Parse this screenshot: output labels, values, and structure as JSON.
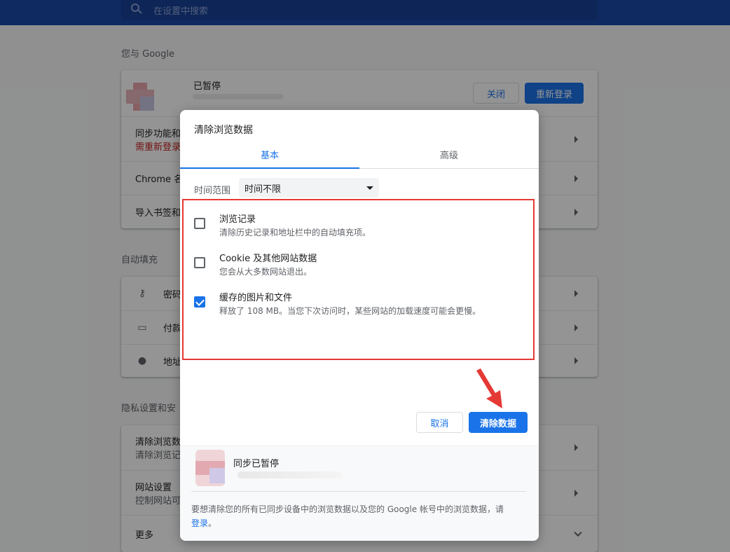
{
  "search": {
    "placeholder": "在设置中搜索"
  },
  "you_and_google": {
    "title": "您与 Google",
    "account_status": "已暂停",
    "close_label": "关闭",
    "relogin_label": "重新登录",
    "rows": [
      {
        "l1": "同步功能和",
        "l2": "需重新登录"
      },
      {
        "l1": "Chrome 名"
      },
      {
        "l1": "导入书签和"
      }
    ]
  },
  "autofill": {
    "title": "自动填充",
    "rows": [
      {
        "icon": "key-icon",
        "label": "密码"
      },
      {
        "icon": "card-icon",
        "label": "付款"
      },
      {
        "icon": "location-icon",
        "label": "地址"
      }
    ]
  },
  "privacy": {
    "title": "隐私设置和安",
    "rows": [
      {
        "l1": "清除浏览数",
        "l2": "清除浏览记"
      },
      {
        "l1": "网站设置",
        "l2": "控制网站可"
      },
      {
        "l1": "更多"
      }
    ]
  },
  "dialog": {
    "title": "清除浏览数据",
    "tabs": [
      "基本",
      "高级"
    ],
    "range_label": "时间范围",
    "range_value": "时间不限",
    "options": [
      {
        "label": "浏览记录",
        "desc": "清除历史记录和地址栏中的自动填充项。",
        "checked": false
      },
      {
        "label": "Cookie 及其他网站数据",
        "desc": "您会从大多数网站退出。",
        "checked": false
      },
      {
        "label": "缓存的图片和文件",
        "desc": "释放了 108 MB。当您下次访问时，某些网站的加载速度可能会更慢。",
        "checked": true
      }
    ],
    "cancel_label": "取消",
    "clear_label": "清除数据",
    "sync_status": "同步已暂停",
    "footer_text": "要想清除您的所有已同步设备中的浏览数据以及您的 Google 帐号中的浏览数据，请",
    "footer_link": "登录",
    "footer_end": "。"
  },
  "colors": {
    "accent": "#1a73e8",
    "highlight_box": "#e53935",
    "header": "#1a49a8"
  }
}
